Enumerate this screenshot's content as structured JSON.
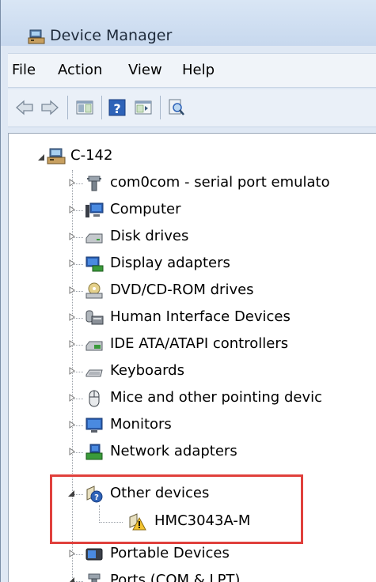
{
  "window": {
    "title": "Device Manager"
  },
  "menu": {
    "file": "File",
    "action": "Action",
    "view": "View",
    "help": "Help"
  },
  "toolbar": {
    "icons": [
      "back-arrow-icon",
      "forward-arrow-icon",
      "properties-icon",
      "help-icon",
      "show-hide-console-tree-icon",
      "scan-hardware-icon"
    ]
  },
  "tree": {
    "root": "C-142",
    "items": [
      {
        "label": "com0com - serial port emulato",
        "icon": "serial-port-icon"
      },
      {
        "label": "Computer",
        "icon": "computer-icon"
      },
      {
        "label": "Disk drives",
        "icon": "disk-drive-icon"
      },
      {
        "label": "Display adapters",
        "icon": "display-adapter-icon"
      },
      {
        "label": "DVD/CD-ROM drives",
        "icon": "dvd-drive-icon"
      },
      {
        "label": "Human Interface Devices",
        "icon": "hid-icon"
      },
      {
        "label": "IDE ATA/ATAPI controllers",
        "icon": "ide-controller-icon"
      },
      {
        "label": "Keyboards",
        "icon": "keyboard-icon"
      },
      {
        "label": "Mice and other pointing devic",
        "icon": "mouse-icon"
      },
      {
        "label": "Monitors",
        "icon": "monitor-icon"
      },
      {
        "label": "Network adapters",
        "icon": "network-adapter-icon"
      },
      {
        "label": "Other devices",
        "icon": "unknown-device-icon"
      },
      {
        "label": "HMC3043A-M",
        "icon": "warning-device-icon"
      },
      {
        "label": "Portable Devices",
        "icon": "portable-device-icon"
      },
      {
        "label": "Ports (COM & LPT)",
        "icon": "port-icon"
      }
    ]
  },
  "colors": {
    "highlight_border": "#e0403c",
    "window_chrome": "#dfe8f4"
  }
}
